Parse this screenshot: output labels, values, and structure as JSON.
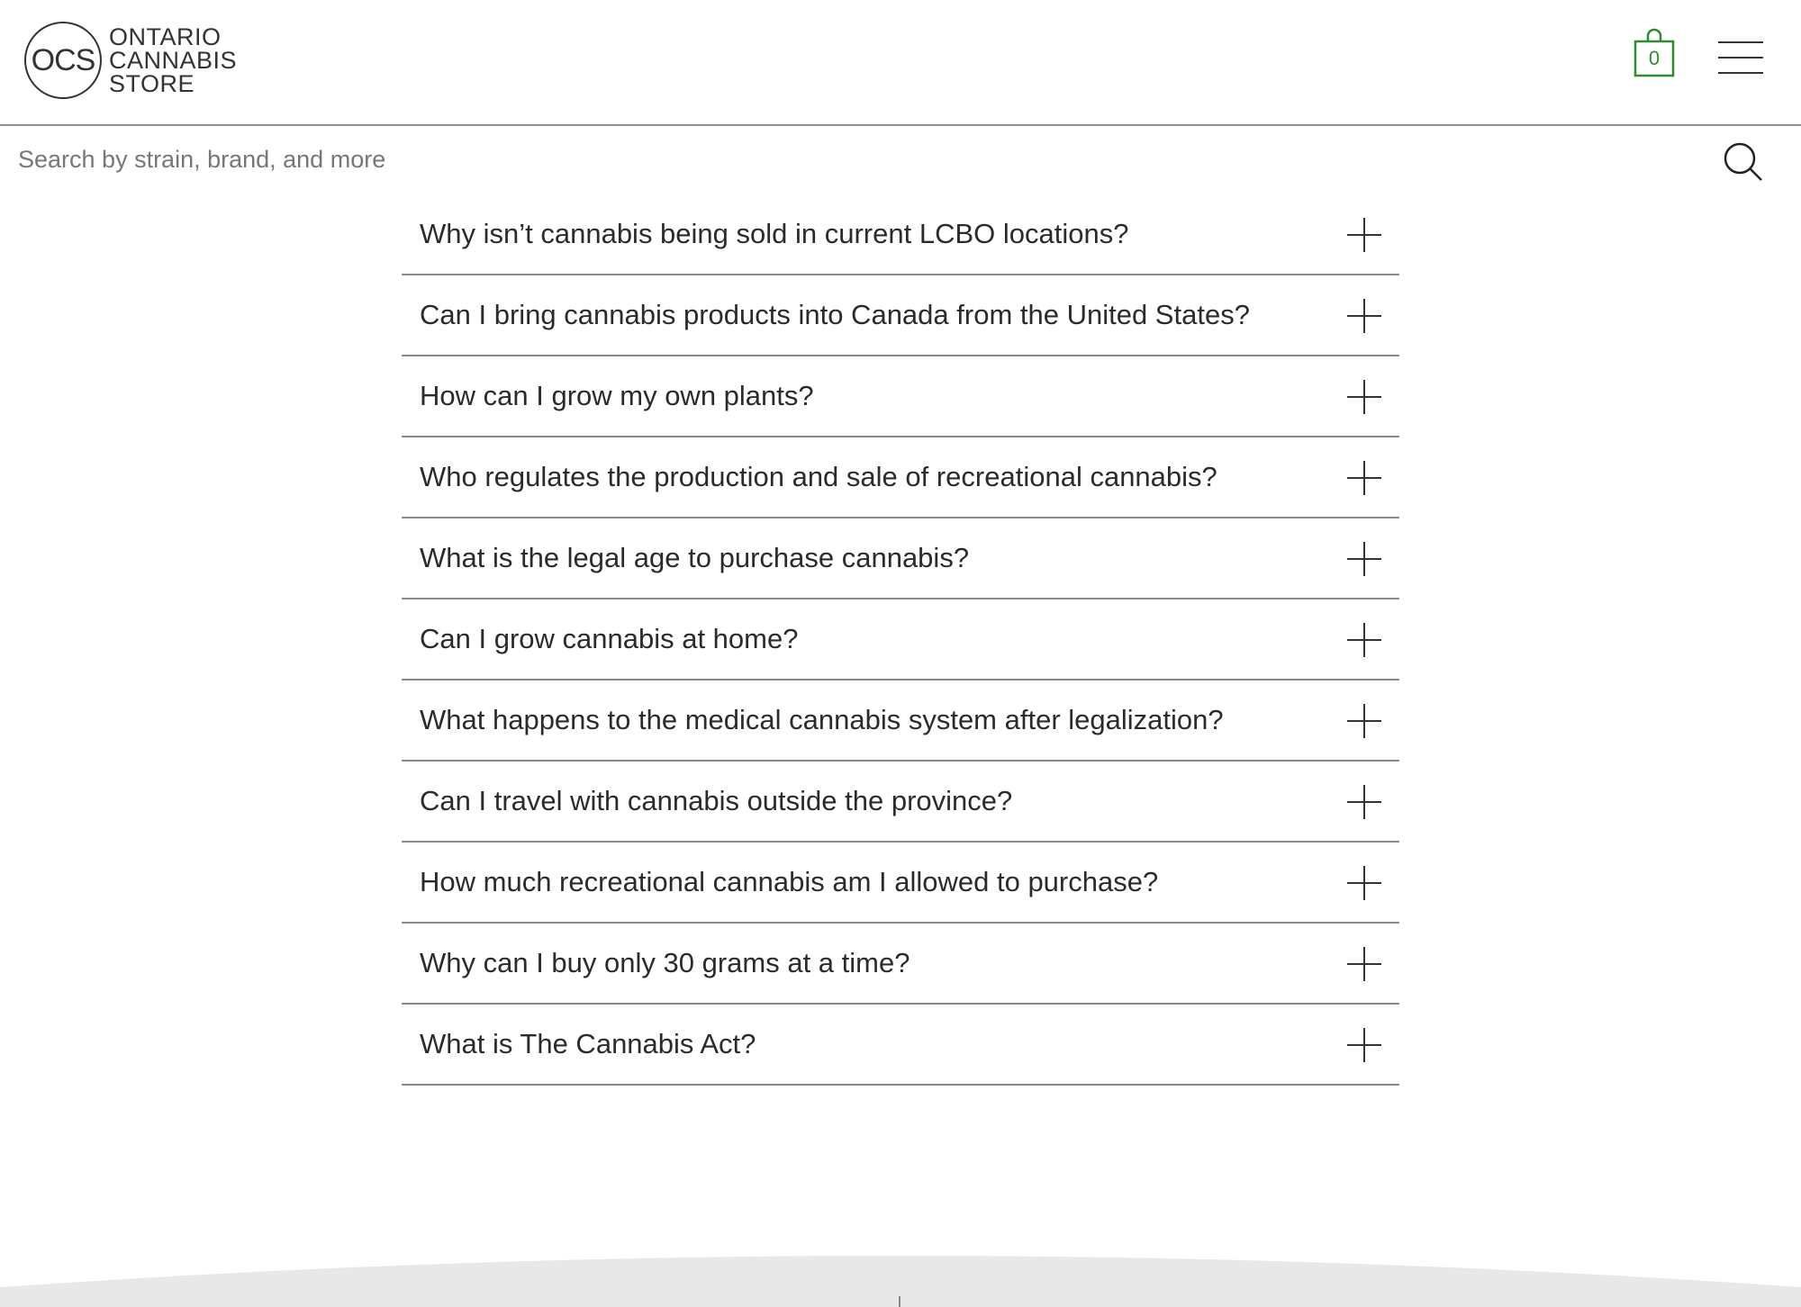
{
  "header": {
    "logo": {
      "mark": "OCS",
      "lines": [
        "ONTARIO",
        "CANNABIS",
        "STORE"
      ]
    },
    "cart": {
      "count": "0",
      "icon": "shopping-bag-icon",
      "color": "#2e8b2e"
    },
    "menu": {
      "icon": "hamburger-menu-icon"
    }
  },
  "search": {
    "placeholder": "Search by strain, brand, and more",
    "value": "",
    "icon": "search-icon"
  },
  "faq": {
    "items": [
      {
        "question": "Why isn’t cannabis being sold in current LCBO locations?",
        "icon": "plus-icon"
      },
      {
        "question": "Can I bring cannabis products into Canada from the United States?",
        "icon": "plus-icon"
      },
      {
        "question": "How can I grow my own plants?",
        "icon": "plus-icon"
      },
      {
        "question": "Who regulates the production and sale of recreational cannabis?",
        "icon": "plus-icon"
      },
      {
        "question": "What is the legal age to purchase cannabis?",
        "icon": "plus-icon"
      },
      {
        "question": "Can I grow cannabis at home?",
        "icon": "plus-icon"
      },
      {
        "question": "What happens to the medical cannabis system after legalization?",
        "icon": "plus-icon"
      },
      {
        "question": "Can I travel with cannabis outside the province?",
        "icon": "plus-icon"
      },
      {
        "question": "How much recreational cannabis am I allowed to purchase?",
        "icon": "plus-icon"
      },
      {
        "question": "Why can I buy only 30 grams at a time?",
        "icon": "plus-icon"
      },
      {
        "question": "What is The Cannabis Act?",
        "icon": "plus-icon"
      }
    ]
  },
  "footer": {
    "background": "#e8e8e8"
  }
}
